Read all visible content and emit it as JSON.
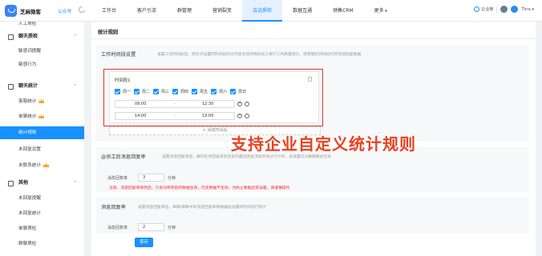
{
  "topbar": {
    "brand": "芝麻微客",
    "account": "公众号",
    "nav": [
      "工作台",
      "客户引流",
      "群管理",
      "营销裂变",
      "会话质检",
      "数据互通",
      "销售CRM",
      "更多"
    ],
    "active_nav": "会话质检",
    "qyw_label": "企业微",
    "user": "Tina"
  },
  "sidebar": {
    "top_partial": "人工质检",
    "group1": "聊天质检",
    "group1_items": [
      "敏感词提醒",
      "敏感行为"
    ],
    "group2": "聊天统计",
    "group2_items": [
      "客服统计",
      "单聊统计",
      "统计规则",
      "未回复设置",
      "未联系统计"
    ],
    "group3": "其他",
    "group3_items": [
      "未回复提醒",
      "未回复统计",
      "单聊质检",
      "群聊质检"
    ]
  },
  "main": {
    "page_title": "统计规则",
    "sec1_title": "工作时间段设置",
    "sec1_desc": "设置工作时间段后，则仅对设置的时间段内对开启会话存档的员工进行工作质量统计，即客服在时间段内的有效回复数据",
    "period": {
      "name": "时间段1",
      "days": [
        "周一",
        "周二",
        "周三",
        "周四",
        "周五",
        "周六",
        "周日"
      ],
      "range1_start": "09:00",
      "range1_end": "12:30",
      "range2_start": "14:00",
      "range2_end": "19:00",
      "dash": "-"
    },
    "add_period": "+ 添加时间段",
    "sec2_title": "@员工后消息回复率",
    "sec2_desc": "设置消息回复率后，群内在同回复率的消息的最后回复消息时间过行计时，该设置仅对群聊模式生效",
    "reply_label": "消息回复率",
    "reply_value": "3",
    "reply_unit": "分钟",
    "warn": "注意，消息回复率修改后，只会对修改后的数据生效，历史数据不生效，为防止数据出现误差，请谨慎操作",
    "sec3_title": "消息回复率",
    "sec3_desc": "设置消息回复率后，单聊/单聊中的消息回复率将根据此设置的时间进行统计",
    "reply2_label": "消息回复率",
    "reply2_value": "2",
    "reply2_unit": "分钟",
    "save": "保存"
  },
  "annotation": "支持企业自定义统计规则",
  "colors": {
    "accent": "#1890ff",
    "annotation": "#e8421f",
    "warn": "#f5222d"
  }
}
